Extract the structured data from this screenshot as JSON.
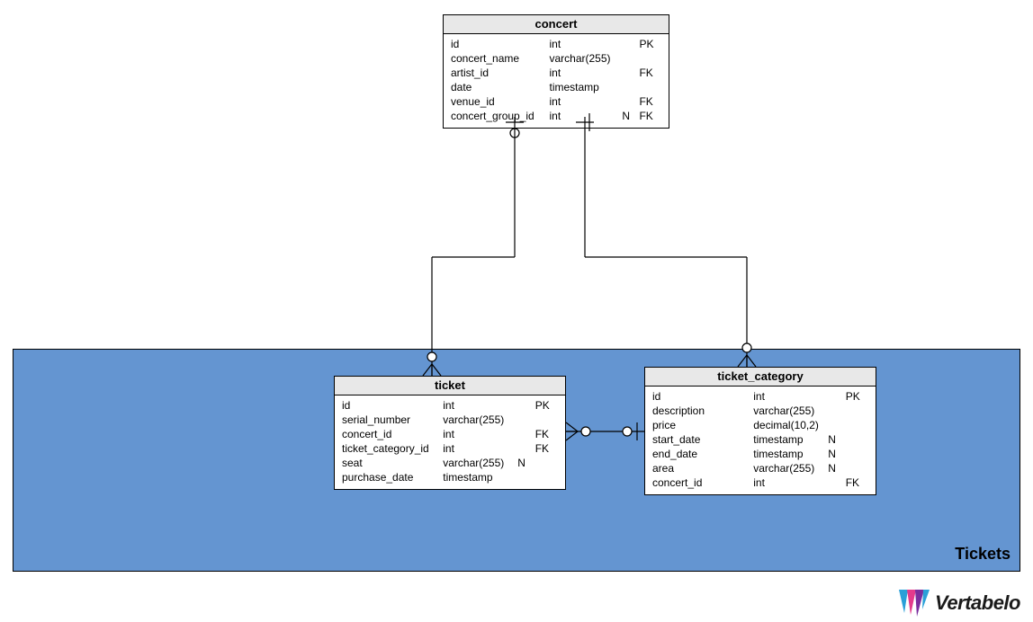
{
  "subject_area": {
    "label": "Tickets"
  },
  "entities": {
    "concert": {
      "title": "concert",
      "rows": [
        {
          "name": "id",
          "type": "int",
          "nul": "",
          "key": "PK"
        },
        {
          "name": "concert_name",
          "type": "varchar(255)",
          "nul": "",
          "key": ""
        },
        {
          "name": "artist_id",
          "type": "int",
          "nul": "",
          "key": "FK"
        },
        {
          "name": "date",
          "type": "timestamp",
          "nul": "",
          "key": ""
        },
        {
          "name": "venue_id",
          "type": "int",
          "nul": "",
          "key": "FK"
        },
        {
          "name": "concert_group_id",
          "type": "int",
          "nul": "N",
          "key": "FK"
        }
      ]
    },
    "ticket": {
      "title": "ticket",
      "rows": [
        {
          "name": "id",
          "type": "int",
          "nul": "",
          "key": "PK"
        },
        {
          "name": "serial_number",
          "type": "varchar(255)",
          "nul": "",
          "key": ""
        },
        {
          "name": "concert_id",
          "type": "int",
          "nul": "",
          "key": "FK"
        },
        {
          "name": "ticket_category_id",
          "type": "int",
          "nul": "",
          "key": "FK"
        },
        {
          "name": "seat",
          "type": "varchar(255)",
          "nul": "N",
          "key": ""
        },
        {
          "name": "purchase_date",
          "type": "timestamp",
          "nul": "",
          "key": ""
        }
      ]
    },
    "ticket_category": {
      "title": "ticket_category",
      "rows": [
        {
          "name": "id",
          "type": "int",
          "nul": "",
          "key": "PK"
        },
        {
          "name": "description",
          "type": "varchar(255)",
          "nul": "",
          "key": ""
        },
        {
          "name": "price",
          "type": "decimal(10,2)",
          "nul": "",
          "key": ""
        },
        {
          "name": "start_date",
          "type": "timestamp",
          "nul": "N",
          "key": ""
        },
        {
          "name": "end_date",
          "type": "timestamp",
          "nul": "N",
          "key": ""
        },
        {
          "name": "area",
          "type": "varchar(255)",
          "nul": "N",
          "key": ""
        },
        {
          "name": "concert_id",
          "type": "int",
          "nul": "",
          "key": "FK"
        }
      ]
    }
  },
  "logo_text": "Vertabelo",
  "chart_data": {
    "type": "erd",
    "subject_areas": [
      {
        "name": "Tickets",
        "contains": [
          "ticket",
          "ticket_category"
        ]
      }
    ],
    "tables": [
      {
        "name": "concert",
        "columns": [
          {
            "name": "id",
            "type": "int",
            "pk": true
          },
          {
            "name": "concert_name",
            "type": "varchar(255)"
          },
          {
            "name": "artist_id",
            "type": "int",
            "fk": true
          },
          {
            "name": "date",
            "type": "timestamp"
          },
          {
            "name": "venue_id",
            "type": "int",
            "fk": true
          },
          {
            "name": "concert_group_id",
            "type": "int",
            "fk": true,
            "nullable": true
          }
        ]
      },
      {
        "name": "ticket",
        "columns": [
          {
            "name": "id",
            "type": "int",
            "pk": true
          },
          {
            "name": "serial_number",
            "type": "varchar(255)"
          },
          {
            "name": "concert_id",
            "type": "int",
            "fk": true
          },
          {
            "name": "ticket_category_id",
            "type": "int",
            "fk": true
          },
          {
            "name": "seat",
            "type": "varchar(255)",
            "nullable": true
          },
          {
            "name": "purchase_date",
            "type": "timestamp"
          }
        ]
      },
      {
        "name": "ticket_category",
        "columns": [
          {
            "name": "id",
            "type": "int",
            "pk": true
          },
          {
            "name": "description",
            "type": "varchar(255)"
          },
          {
            "name": "price",
            "type": "decimal(10,2)"
          },
          {
            "name": "start_date",
            "type": "timestamp",
            "nullable": true
          },
          {
            "name": "end_date",
            "type": "timestamp",
            "nullable": true
          },
          {
            "name": "area",
            "type": "varchar(255)",
            "nullable": true
          },
          {
            "name": "concert_id",
            "type": "int",
            "fk": true
          }
        ]
      }
    ],
    "relationships": [
      {
        "from": "concert",
        "to": "ticket",
        "from_card": "1",
        "to_card": "0..*",
        "optional_at_parent": true
      },
      {
        "from": "concert",
        "to": "ticket_category",
        "from_card": "1",
        "to_card": "0..*",
        "optional_at_parent": true
      },
      {
        "from": "ticket_category",
        "to": "ticket",
        "from_card": "1",
        "to_card": "0..*",
        "optional_at_parent": true
      }
    ]
  }
}
